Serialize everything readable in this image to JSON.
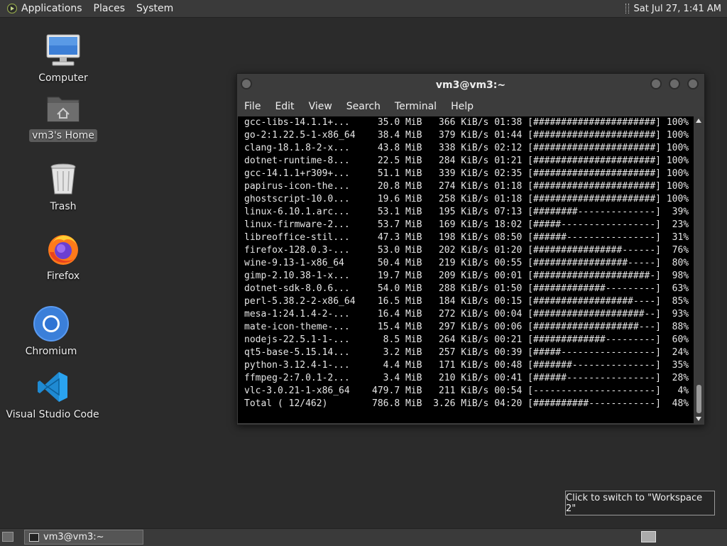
{
  "top_panel": {
    "menus": [
      "Applications",
      "Places",
      "System"
    ],
    "clock": "Sat Jul 27,  1:41 AM"
  },
  "desktop_icons": [
    {
      "label": "Computer"
    },
    {
      "label": "vm3's Home"
    },
    {
      "label": "Trash"
    },
    {
      "label": "Firefox"
    },
    {
      "label": "Chromium"
    },
    {
      "label": "Visual Studio Code"
    }
  ],
  "terminal": {
    "title": "vm3@vm3:~",
    "menu": [
      "File",
      "Edit",
      "View",
      "Search",
      "Terminal",
      "Help"
    ],
    "lines": [
      "gcc-libs-14.1.1+...     35.0 MiB   366 KiB/s 01:38 [######################] 100%",
      "go-2:1.22.5-1-x86_64    38.4 MiB   379 KiB/s 01:44 [######################] 100%",
      "clang-18.1.8-2-x...     43.8 MiB   338 KiB/s 02:12 [######################] 100%",
      "dotnet-runtime-8...     22.5 MiB   284 KiB/s 01:21 [######################] 100%",
      "gcc-14.1.1+r309+...     51.1 MiB   339 KiB/s 02:35 [######################] 100%",
      "papirus-icon-the...     20.8 MiB   274 KiB/s 01:18 [######################] 100%",
      "ghostscript-10.0...     19.6 MiB   258 KiB/s 01:18 [######################] 100%",
      "linux-6.10.1.arc...     53.1 MiB   195 KiB/s 07:13 [########--------------]  39%",
      "linux-firmware-2...     53.7 MiB   169 KiB/s 18:02 [#####-----------------]  23%",
      "libreoffice-stil...     47.3 MiB   198 KiB/s 08:50 [######----------------]  31%",
      "firefox-128.0.3-...     53.0 MiB   202 KiB/s 01:20 [################------]  76%",
      "wine-9.13-1-x86_64      50.4 MiB   219 KiB/s 00:55 [#################-----]  80%",
      "gimp-2.10.38-1-x...     19.7 MiB   209 KiB/s 00:01 [#####################-]  98%",
      "dotnet-sdk-8.0.6...     54.0 MiB   288 KiB/s 01:50 [#############---------]  63%",
      "perl-5.38.2-2-x86_64    16.5 MiB   184 KiB/s 00:15 [##################----]  85%",
      "mesa-1:24.1.4-2-...     16.4 MiB   272 KiB/s 00:04 [####################--]  93%",
      "mate-icon-theme-...     15.4 MiB   297 KiB/s 00:06 [###################---]  88%",
      "nodejs-22.5.1-1-...      8.5 MiB   264 KiB/s 00:21 [#############---------]  60%",
      "qt5-base-5.15.14...      3.2 MiB   257 KiB/s 00:39 [#####-----------------]  24%",
      "python-3.12.4-1-...      4.4 MiB   171 KiB/s 00:48 [#######---------------]  35%",
      "ffmpeg-2:7.0.1-2...      3.4 MiB   210 KiB/s 00:41 [######----------------]  28%",
      "vlc-3.0.21-1-x86_64    479.7 MiB   211 KiB/s 00:54 [----------------------]   4%",
      "Total ( 12/462)        786.8 MiB  3.26 MiB/s 04:20 [##########------------]  48%"
    ]
  },
  "tooltip": "Click to switch to \"Workspace 2\"",
  "taskbar": {
    "window_label": "vm3@vm3:~"
  }
}
